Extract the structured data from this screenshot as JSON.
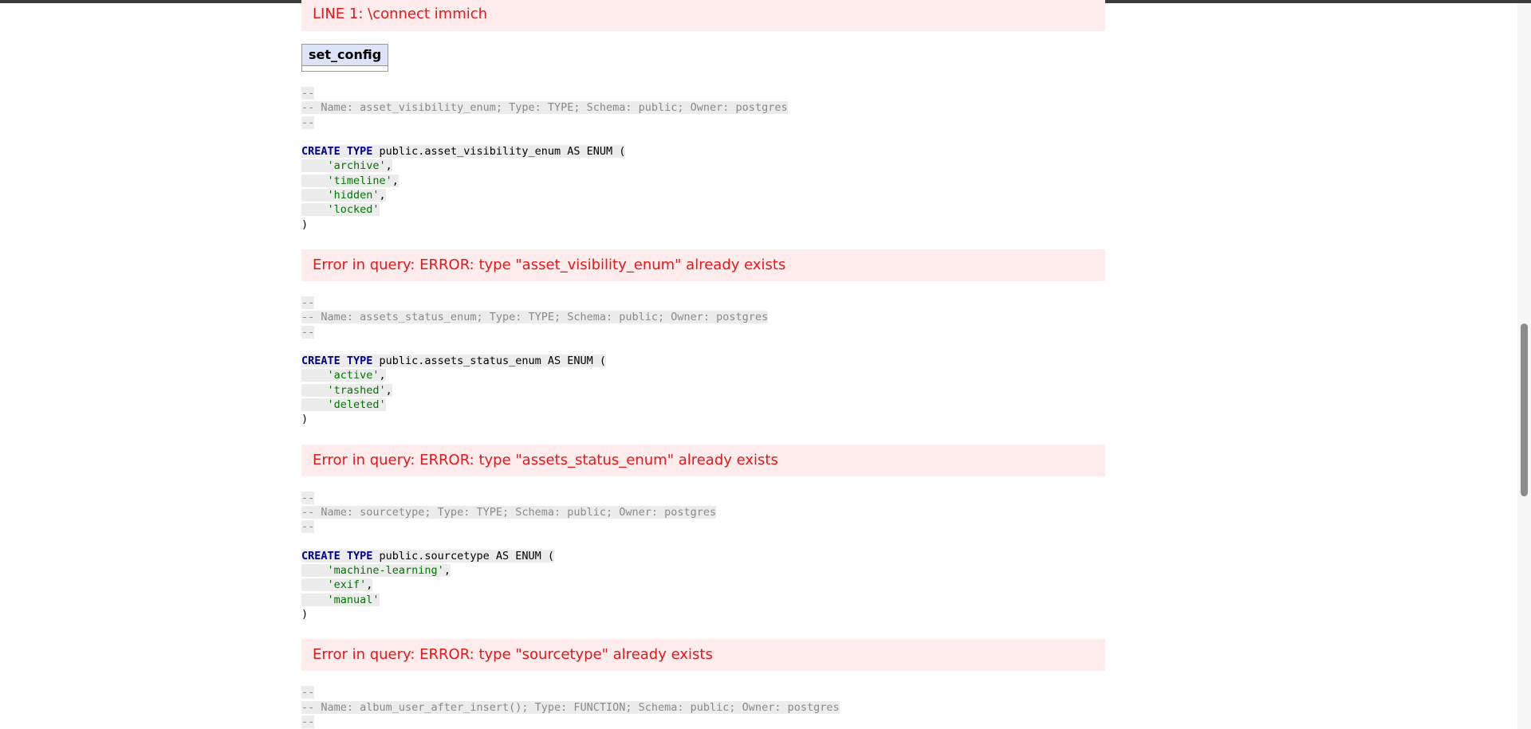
{
  "errors": {
    "connect": "LINE 1: \\connect immich",
    "asset_visibility": "Error in query: ERROR: type \"asset_visibility_enum\" already exists",
    "assets_status": "Error in query: ERROR: type \"assets_status_enum\" already exists",
    "sourcetype": "Error in query: ERROR: type \"sourcetype\" already exists"
  },
  "result_table": {
    "header": "set_config"
  },
  "blocks": {
    "asset_visibility": {
      "comment_sep": "--",
      "comment": "-- Name: asset_visibility_enum; Type: TYPE; Schema: public; Owner: postgres",
      "keyword": "CREATE TYPE",
      "rest": " public.asset_visibility_enum AS ENUM (",
      "values": [
        "'archive'",
        "'timeline'",
        "'hidden'",
        "'locked'"
      ],
      "close": ")"
    },
    "assets_status": {
      "comment_sep": "--",
      "comment": "-- Name: assets_status_enum; Type: TYPE; Schema: public; Owner: postgres",
      "keyword": "CREATE TYPE",
      "rest": " public.assets_status_enum AS ENUM (",
      "values": [
        "'active'",
        "'trashed'",
        "'deleted'"
      ],
      "close": ")"
    },
    "sourcetype": {
      "comment_sep": "--",
      "comment": "-- Name: sourcetype; Type: TYPE; Schema: public; Owner: postgres",
      "keyword": "CREATE TYPE",
      "rest": " public.sourcetype AS ENUM (",
      "values": [
        "'machine-learning'",
        "'exif'",
        "'manual'"
      ],
      "close": ")"
    },
    "album_user": {
      "comment_sep": "--",
      "comment": "-- Name: album_user_after_insert(); Type: FUNCTION; Schema: public; Owner: postgres"
    }
  }
}
